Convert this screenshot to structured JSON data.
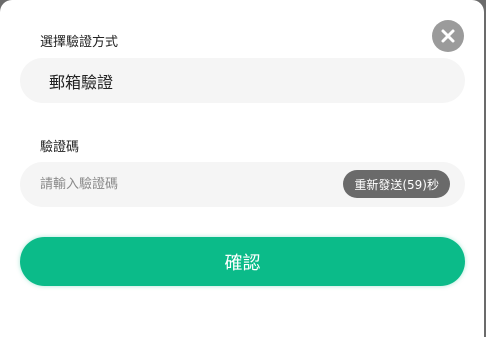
{
  "dialog": {
    "method_label": "選擇驗證方式",
    "method_value": "郵箱驗證",
    "code_label": "驗證碼",
    "code_placeholder": "請輸入驗證碼",
    "code_value": "",
    "resend_label": "重新發送(59)秒",
    "confirm_label": "確認",
    "close_icon": "close-icon"
  },
  "colors": {
    "primary": "#0bbb89",
    "resend_bg": "#6a6a6a",
    "close_bg": "#9b9b9b",
    "field_bg": "#f5f5f5"
  }
}
